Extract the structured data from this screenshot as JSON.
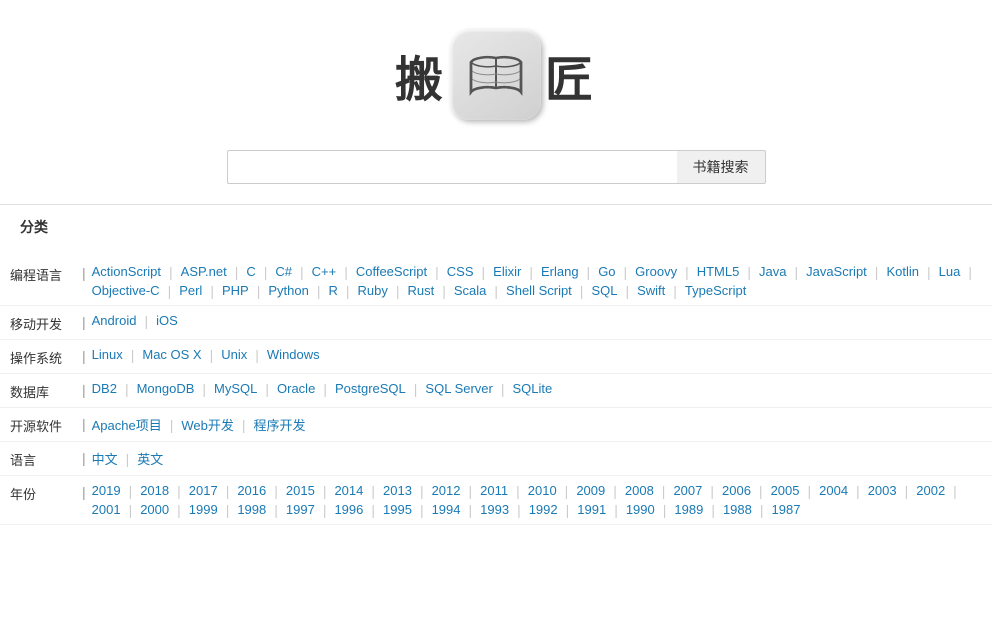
{
  "header": {
    "logo_text_left": "搬",
    "logo_text_right": "匠",
    "logo_icon_alt": "open book"
  },
  "search": {
    "placeholder": "",
    "button_label": "书籍搜索"
  },
  "section": {
    "title": "分类"
  },
  "categories": {
    "programming_lang": {
      "label": "编程语言",
      "tags": [
        "ActionScript",
        "ASP.net",
        "C",
        "C#",
        "C++",
        "CoffeeScript",
        "CSS",
        "Elixir",
        "Erlang",
        "Go",
        "Groovy",
        "HTML5",
        "Java",
        "JavaScript",
        "Kotlin",
        "Lua",
        "Objective-C",
        "Perl",
        "PHP",
        "Python",
        "R",
        "Ruby",
        "Rust",
        "Scala",
        "Shell Script",
        "SQL",
        "Swift",
        "TypeScript"
      ]
    },
    "mobile": {
      "label": "移动开发",
      "tags": [
        "Android",
        "iOS"
      ]
    },
    "os": {
      "label": "操作系统",
      "tags": [
        "Linux",
        "Mac OS X",
        "Unix",
        "Windows"
      ]
    },
    "database": {
      "label": "数据库",
      "tags": [
        "DB2",
        "MongoDB",
        "MySQL",
        "Oracle",
        "PostgreSQL",
        "SQL Server",
        "SQLite"
      ]
    },
    "opensource": {
      "label": "开源软件",
      "tags": [
        "Apache项目",
        "Web开发",
        "程序开发"
      ]
    },
    "language": {
      "label": "语言",
      "tags": [
        "中文",
        "英文"
      ]
    },
    "year": {
      "label": "年份",
      "tags": [
        "2019",
        "2018",
        "2017",
        "2016",
        "2015",
        "2014",
        "2013",
        "2012",
        "2011",
        "2010",
        "2009",
        "2008",
        "2007",
        "2006",
        "2005",
        "2004",
        "2003",
        "2002",
        "2001",
        "2000",
        "1999",
        "1998",
        "1997",
        "1996",
        "1995",
        "1994",
        "1993",
        "1992",
        "1991",
        "1990",
        "1989",
        "1988",
        "1987"
      ]
    }
  }
}
